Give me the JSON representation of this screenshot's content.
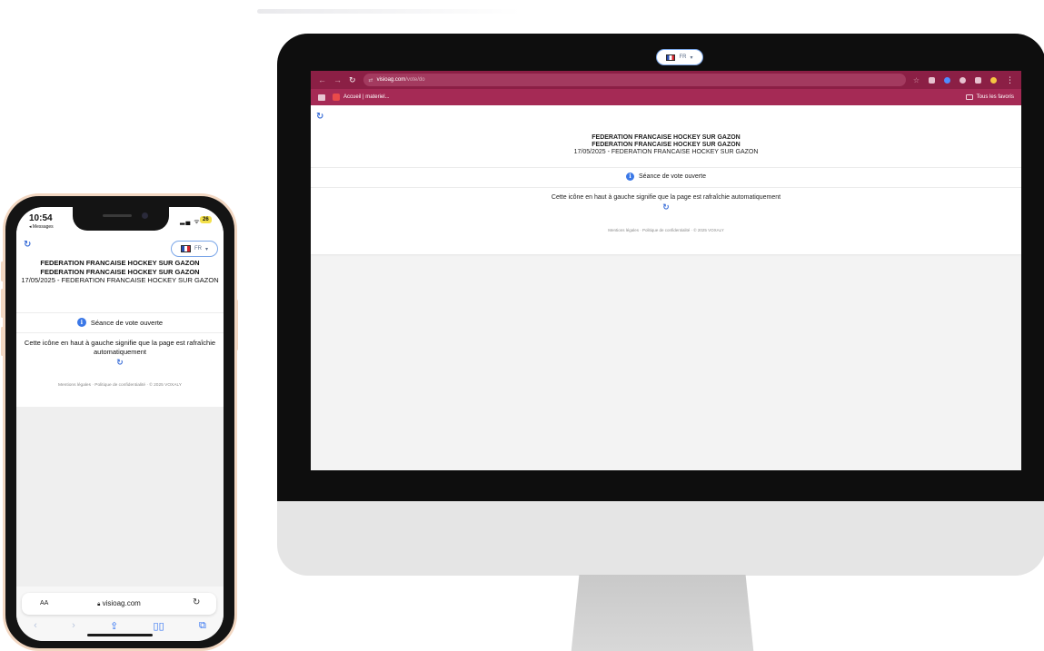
{
  "desktop": {
    "browser": {
      "url_host": "visioag.com",
      "url_path": "/vote/do",
      "bookmark_label": "Accueil | materiel...",
      "bookmarks_right_label": "Tous les favoris"
    },
    "page": {
      "lang_label": "FR",
      "org_title": "FEDERATION FRANCAISE HOCKEY SUR GAZON",
      "org_subtitle": "FEDERATION FRANCAISE HOCKEY SUR GAZON",
      "event_line": "17/05/2025 - FEDERATION FRANCAISE HOCKEY SUR GAZON",
      "status_text": "Séance de vote ouverte",
      "help_text": "Cette icône en haut à gauche signifie que la page est rafraîchie automatiquement",
      "footer_text": "Mentions légales · Politique de confidentialité · © 2025 VOXALY"
    }
  },
  "phone": {
    "status_bar": {
      "time": "10:54",
      "back_label": "◂ Messages",
      "battery": "26"
    },
    "page": {
      "lang_label": "FR",
      "org_title": "FEDERATION FRANCAISE HOCKEY SUR GAZON",
      "org_subtitle": "FEDERATION FRANCAISE HOCKEY SUR GAZON",
      "event_line": "17/05/2025 - FEDERATION FRANCAISE HOCKEY SUR GAZON",
      "status_text": "Séance de vote ouverte",
      "help_text": "Cette icône en haut à gauche signifie que la page est rafraîchie automatiquement",
      "footer_text": "Mentions légales · Politique de confidentialité · © 2025 VOXALY"
    },
    "safari": {
      "text_size_label": "AA",
      "url": "visioag.com"
    }
  },
  "icons": {
    "refresh": "↻",
    "info": "i",
    "dropdown": "▾"
  },
  "colors": {
    "browser_top": "#8b1f45",
    "browser_bookmarks": "#a52a55",
    "accent_blue": "#3b78e7"
  }
}
